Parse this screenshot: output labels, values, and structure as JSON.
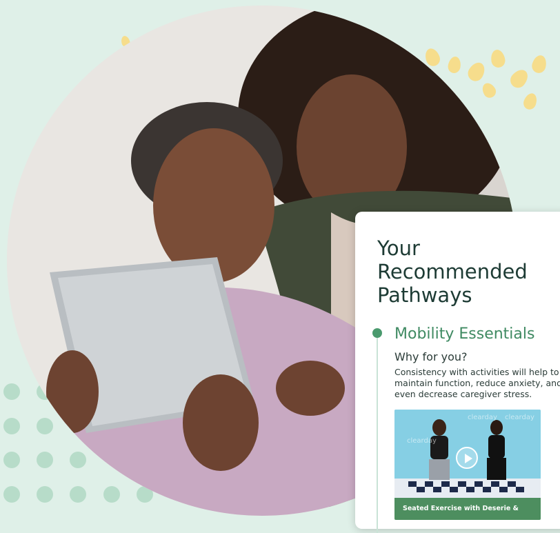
{
  "card": {
    "title": "Your Recommended Pathways",
    "pathway": {
      "name": "Mobility Essentials",
      "subheading": "Why for you?",
      "description": "Consistency with activities will help to maintain function, reduce anxiety, and even decrease caregiver stress.",
      "video": {
        "caption": "Seated Exercise with Deserie & Tiffany",
        "backdrop_text": "clearday"
      }
    }
  },
  "colors": {
    "background": "#dff0e8",
    "accent_green": "#4a9a6e",
    "title_dark": "#1d3b34",
    "dot_green": "#b7dcc9",
    "leaf_yellow": "#f6dd8c"
  },
  "icons": [
    "play-icon",
    "timeline-dot-icon"
  ]
}
